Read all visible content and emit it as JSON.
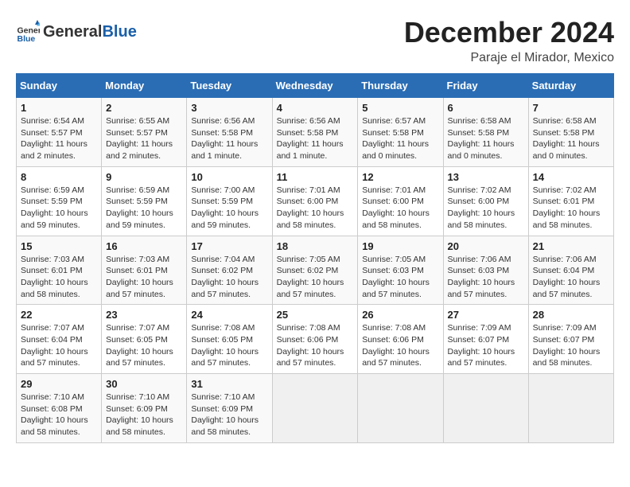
{
  "header": {
    "logo_general": "General",
    "logo_blue": "Blue",
    "month_title": "December 2024",
    "location": "Paraje el Mirador, Mexico"
  },
  "calendar": {
    "days_of_week": [
      "Sunday",
      "Monday",
      "Tuesday",
      "Wednesday",
      "Thursday",
      "Friday",
      "Saturday"
    ],
    "weeks": [
      [
        {
          "day": "",
          "info": ""
        },
        {
          "day": "2",
          "info": "Sunrise: 6:55 AM\nSunset: 5:57 PM\nDaylight: 11 hours\nand 2 minutes."
        },
        {
          "day": "3",
          "info": "Sunrise: 6:56 AM\nSunset: 5:58 PM\nDaylight: 11 hours\nand 1 minute."
        },
        {
          "day": "4",
          "info": "Sunrise: 6:56 AM\nSunset: 5:58 PM\nDaylight: 11 hours\nand 1 minute."
        },
        {
          "day": "5",
          "info": "Sunrise: 6:57 AM\nSunset: 5:58 PM\nDaylight: 11 hours\nand 0 minutes."
        },
        {
          "day": "6",
          "info": "Sunrise: 6:58 AM\nSunset: 5:58 PM\nDaylight: 11 hours\nand 0 minutes."
        },
        {
          "day": "7",
          "info": "Sunrise: 6:58 AM\nSunset: 5:58 PM\nDaylight: 11 hours\nand 0 minutes."
        }
      ],
      [
        {
          "day": "1",
          "info": "Sunrise: 6:54 AM\nSunset: 5:57 PM\nDaylight: 11 hours\nand 2 minutes."
        },
        {
          "day": "9",
          "info": "Sunrise: 6:59 AM\nSunset: 5:59 PM\nDaylight: 10 hours\nand 59 minutes."
        },
        {
          "day": "10",
          "info": "Sunrise: 7:00 AM\nSunset: 5:59 PM\nDaylight: 10 hours\nand 59 minutes."
        },
        {
          "day": "11",
          "info": "Sunrise: 7:01 AM\nSunset: 6:00 PM\nDaylight: 10 hours\nand 58 minutes."
        },
        {
          "day": "12",
          "info": "Sunrise: 7:01 AM\nSunset: 6:00 PM\nDaylight: 10 hours\nand 58 minutes."
        },
        {
          "day": "13",
          "info": "Sunrise: 7:02 AM\nSunset: 6:00 PM\nDaylight: 10 hours\nand 58 minutes."
        },
        {
          "day": "14",
          "info": "Sunrise: 7:02 AM\nSunset: 6:01 PM\nDaylight: 10 hours\nand 58 minutes."
        }
      ],
      [
        {
          "day": "8",
          "info": "Sunrise: 6:59 AM\nSunset: 5:59 PM\nDaylight: 10 hours\nand 59 minutes."
        },
        {
          "day": "16",
          "info": "Sunrise: 7:03 AM\nSunset: 6:01 PM\nDaylight: 10 hours\nand 57 minutes."
        },
        {
          "day": "17",
          "info": "Sunrise: 7:04 AM\nSunset: 6:02 PM\nDaylight: 10 hours\nand 57 minutes."
        },
        {
          "day": "18",
          "info": "Sunrise: 7:05 AM\nSunset: 6:02 PM\nDaylight: 10 hours\nand 57 minutes."
        },
        {
          "day": "19",
          "info": "Sunrise: 7:05 AM\nSunset: 6:03 PM\nDaylight: 10 hours\nand 57 minutes."
        },
        {
          "day": "20",
          "info": "Sunrise: 7:06 AM\nSunset: 6:03 PM\nDaylight: 10 hours\nand 57 minutes."
        },
        {
          "day": "21",
          "info": "Sunrise: 7:06 AM\nSunset: 6:04 PM\nDaylight: 10 hours\nand 57 minutes."
        }
      ],
      [
        {
          "day": "15",
          "info": "Sunrise: 7:03 AM\nSunset: 6:01 PM\nDaylight: 10 hours\nand 58 minutes."
        },
        {
          "day": "23",
          "info": "Sunrise: 7:07 AM\nSunset: 6:05 PM\nDaylight: 10 hours\nand 57 minutes."
        },
        {
          "day": "24",
          "info": "Sunrise: 7:08 AM\nSunset: 6:05 PM\nDaylight: 10 hours\nand 57 minutes."
        },
        {
          "day": "25",
          "info": "Sunrise: 7:08 AM\nSunset: 6:06 PM\nDaylight: 10 hours\nand 57 minutes."
        },
        {
          "day": "26",
          "info": "Sunrise: 7:08 AM\nSunset: 6:06 PM\nDaylight: 10 hours\nand 57 minutes."
        },
        {
          "day": "27",
          "info": "Sunrise: 7:09 AM\nSunset: 6:07 PM\nDaylight: 10 hours\nand 57 minutes."
        },
        {
          "day": "28",
          "info": "Sunrise: 7:09 AM\nSunset: 6:07 PM\nDaylight: 10 hours\nand 58 minutes."
        }
      ],
      [
        {
          "day": "22",
          "info": "Sunrise: 7:07 AM\nSunset: 6:04 PM\nDaylight: 10 hours\nand 57 minutes."
        },
        {
          "day": "30",
          "info": "Sunrise: 7:10 AM\nSunset: 6:09 PM\nDaylight: 10 hours\nand 58 minutes."
        },
        {
          "day": "31",
          "info": "Sunrise: 7:10 AM\nSunset: 6:09 PM\nDaylight: 10 hours\nand 58 minutes."
        },
        {
          "day": "",
          "info": ""
        },
        {
          "day": "",
          "info": ""
        },
        {
          "day": "",
          "info": ""
        },
        {
          "day": "",
          "info": ""
        }
      ],
      [
        {
          "day": "29",
          "info": "Sunrise: 7:10 AM\nSunset: 6:08 PM\nDaylight: 10 hours\nand 58 minutes."
        },
        {
          "day": "",
          "info": ""
        },
        {
          "day": "",
          "info": ""
        },
        {
          "day": "",
          "info": ""
        },
        {
          "day": "",
          "info": ""
        },
        {
          "day": "",
          "info": ""
        },
        {
          "day": "",
          "info": ""
        }
      ]
    ]
  }
}
